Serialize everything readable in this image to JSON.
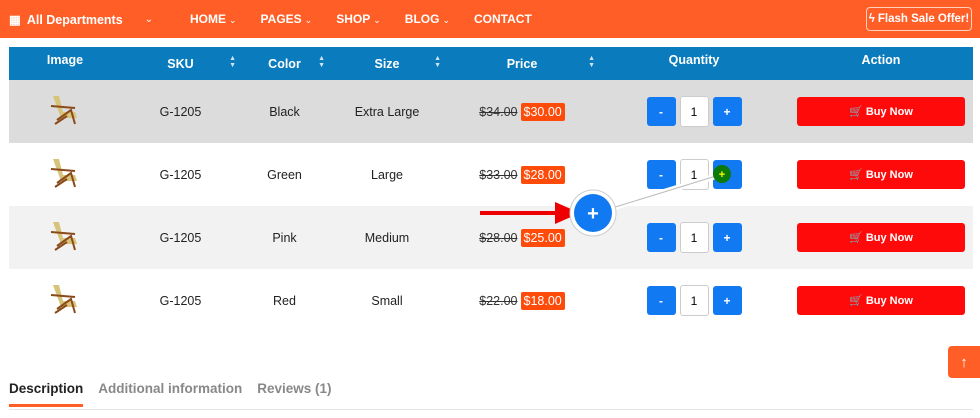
{
  "nav": {
    "departments": "All Departments",
    "menu": [
      "HOME",
      "PAGES",
      "SHOP",
      "BLOG",
      "CONTACT"
    ],
    "flash": "Flash Sale Offer!"
  },
  "table": {
    "headers": [
      "Image",
      "SKU",
      "Color",
      "Size",
      "Price",
      "Quantity",
      "Action"
    ],
    "rows": [
      {
        "sku": "G-1205",
        "color": "Black",
        "size": "Extra Large",
        "old": "$34.00",
        "new": "$30.00",
        "qty": "1"
      },
      {
        "sku": "G-1205",
        "color": "Green",
        "size": "Large",
        "old": "$33.00",
        "new": "$28.00",
        "qty": "1"
      },
      {
        "sku": "G-1205",
        "color": "Pink",
        "size": "Medium",
        "old": "$28.00",
        "new": "$25.00",
        "qty": "1"
      },
      {
        "sku": "G-1205",
        "color": "Red",
        "size": "Small",
        "old": "$22.00",
        "new": "$18.00",
        "qty": "1"
      }
    ],
    "minus": "-",
    "plus": "+",
    "buy": "Buy Now"
  },
  "tabs": [
    "Description",
    "Additional information",
    "Reviews (1)"
  ],
  "colors": {
    "brand": "#ff5e26",
    "header": "#0a7bbd",
    "qty": "#1179f2",
    "buy": "#ff0a0a"
  }
}
